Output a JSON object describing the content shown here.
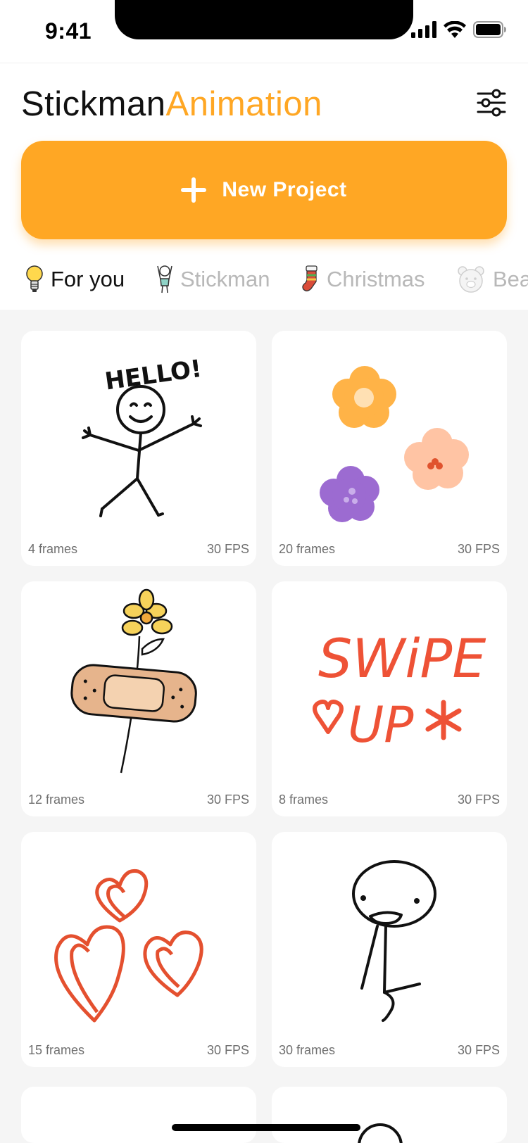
{
  "status": {
    "time": "9:41"
  },
  "header": {
    "title_part1": "Stickman",
    "title_part2": "Animation",
    "settings_icon": "sliders-icon"
  },
  "new_project": {
    "label": "New Project",
    "icon": "plus-icon"
  },
  "tabs": [
    {
      "label": "For you",
      "icon": "lightbulb-icon",
      "active": true
    },
    {
      "label": "Stickman",
      "icon": "stickman-icon",
      "active": false
    },
    {
      "label": "Christmas",
      "icon": "stocking-icon",
      "active": false
    },
    {
      "label": "Bea",
      "icon": "bear-icon",
      "active": false
    }
  ],
  "cards": [
    {
      "frames": "4 frames",
      "fps": "30 FPS",
      "art": "hello-stickman",
      "caption_art": "HELLO!"
    },
    {
      "frames": "20 frames",
      "fps": "30 FPS",
      "art": "flowers"
    },
    {
      "frames": "12 frames",
      "fps": "30 FPS",
      "art": "bandage-flower"
    },
    {
      "frames": "8 frames",
      "fps": "30 FPS",
      "art": "swipe-up",
      "line1_art": "SWiPE",
      "line2_art": "UP"
    },
    {
      "frames": "15 frames",
      "fps": "30 FPS",
      "art": "hearts"
    },
    {
      "frames": "30 frames",
      "fps": "30 FPS",
      "art": "sitting-stickman"
    }
  ],
  "colors": {
    "accent": "#FFA724",
    "swipe_red": "#EE5236",
    "muted_tab": "#b8b8b8"
  }
}
